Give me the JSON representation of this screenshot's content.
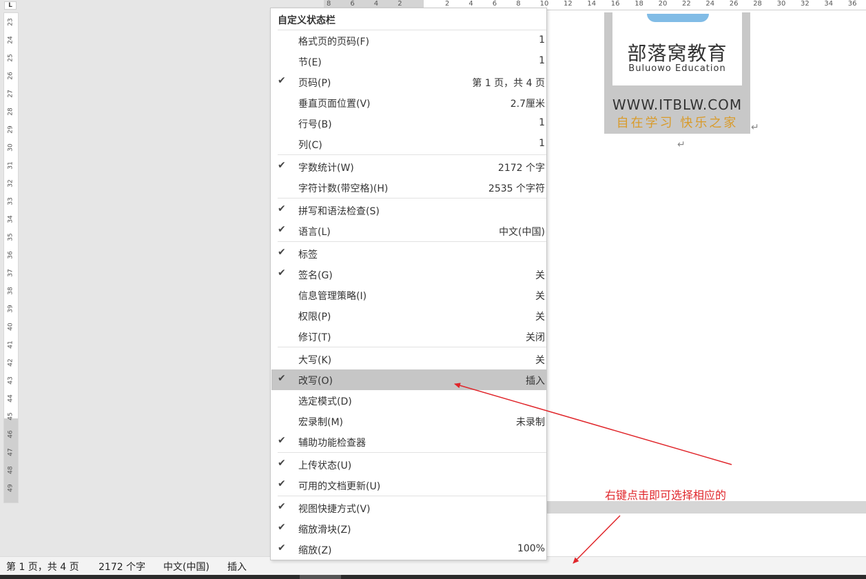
{
  "app": {
    "corner_mark": "L"
  },
  "vertical_ruler": {
    "ticks": [
      "23",
      "24",
      "25",
      "26",
      "27",
      "28",
      "29",
      "30",
      "31",
      "32",
      "33",
      "34",
      "35",
      "36",
      "37",
      "38",
      "39",
      "40",
      "41",
      "42",
      "43",
      "44",
      "45",
      "46",
      "47",
      "48",
      "49"
    ]
  },
  "horizontal_ruler": {
    "ticks": [
      "8",
      "6",
      "4",
      "2",
      "",
      "2",
      "4",
      "6",
      "8",
      "10",
      "12",
      "14",
      "16",
      "18",
      "20",
      "22",
      "24",
      "26",
      "28",
      "30",
      "32",
      "34",
      "36"
    ]
  },
  "document": {
    "logo": {
      "name_cn": "部落窝教育",
      "name_en": "Buluowo Education",
      "url": "WWW.ITBLW.COM",
      "slogan": "自在学习 快乐之家"
    },
    "paragraph_mark": "↵"
  },
  "context_menu": {
    "title": "自定义状态栏",
    "check_glyph": "✔",
    "items": [
      {
        "label": "格式页的页码(F)",
        "value": "1",
        "checked": false
      },
      {
        "label": "节(E)",
        "value": "1",
        "checked": false
      },
      {
        "label": "页码(P)",
        "value": "第 1 页，共 4 页",
        "checked": true
      },
      {
        "label": "垂直页面位置(V)",
        "value": "2.7厘米",
        "checked": false
      },
      {
        "label": "行号(B)",
        "value": "1",
        "checked": false
      },
      {
        "label": "列(C)",
        "value": "1",
        "checked": false
      },
      {
        "label": "字数统计(W)",
        "value": "2172 个字",
        "checked": true
      },
      {
        "label": "字符计数(带空格)(H)",
        "value": "2535 个字符",
        "checked": false
      },
      {
        "label": "拼写和语法检查(S)",
        "value": "",
        "checked": true
      },
      {
        "label": "语言(L)",
        "value": "中文(中国)",
        "checked": true
      },
      {
        "label": "标签",
        "value": "",
        "checked": true
      },
      {
        "label": "签名(G)",
        "value": "关",
        "checked": true
      },
      {
        "label": "信息管理策略(I)",
        "value": "关",
        "checked": false
      },
      {
        "label": "权限(P)",
        "value": "关",
        "checked": false
      },
      {
        "label": "修订(T)",
        "value": "关闭",
        "checked": false
      },
      {
        "label": "大写(K)",
        "value": "关",
        "checked": false
      },
      {
        "label": "改写(O)",
        "value": "插入",
        "checked": true,
        "highlighted": true
      },
      {
        "label": "选定模式(D)",
        "value": "",
        "checked": false
      },
      {
        "label": "宏录制(M)",
        "value": "未录制",
        "checked": false
      },
      {
        "label": "辅助功能检查器",
        "value": "",
        "checked": true
      },
      {
        "label": "上传状态(U)",
        "value": "",
        "checked": true
      },
      {
        "label": "可用的文档更新(U)",
        "value": "",
        "checked": true
      },
      {
        "label": "视图快捷方式(V)",
        "value": "",
        "checked": true
      },
      {
        "label": "缩放滑块(Z)",
        "value": "",
        "checked": true
      },
      {
        "label": "缩放(Z)",
        "value": "100%",
        "checked": true
      }
    ]
  },
  "status_bar": {
    "page": "第 1 页，共 4 页",
    "words": "2172 个字",
    "language": "中文(中国)",
    "mode": "插入"
  },
  "annotation": {
    "text": "右键点击即可选择相应的",
    "color": "#e0262b"
  }
}
